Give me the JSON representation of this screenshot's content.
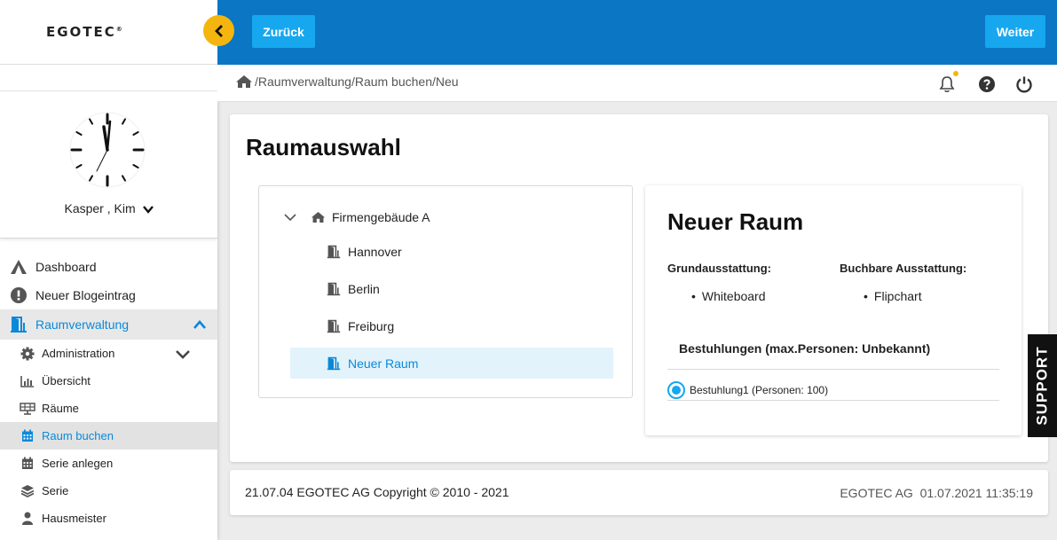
{
  "sidebar": {
    "logo": "EGOTEC",
    "logo_mark": "®",
    "user_name": "Kasper , Kim",
    "nav": [
      {
        "label": "Dashboard",
        "icon": "tent-icon"
      },
      {
        "label": "Neuer Blogeintrag",
        "icon": "alert-circle-icon"
      },
      {
        "label": "Raumverwaltung",
        "icon": "door-icon"
      }
    ],
    "sub_nav": [
      {
        "label": "Administration",
        "icon": "gear-icon"
      },
      {
        "label": "Übersicht",
        "icon": "bar-chart-icon"
      },
      {
        "label": "Räume",
        "icon": "solar-panel-icon"
      },
      {
        "label": "Raum buchen",
        "icon": "calendar-icon"
      },
      {
        "label": "Serie anlegen",
        "icon": "calendar-icon"
      },
      {
        "label": "Serie",
        "icon": "layers-icon"
      },
      {
        "label": "Hausmeister",
        "icon": "user-icon"
      }
    ]
  },
  "header": {
    "back_label": "Zurück",
    "next_label": "Weiter",
    "breadcrumb": "/Raumverwaltung/Raum buchen/Neu"
  },
  "main": {
    "title": "Raumauswahl",
    "tree": {
      "root": "Firmengebäude A",
      "rooms": [
        "Hannover",
        "Berlin",
        "Freiburg",
        "Neuer Raum"
      ]
    },
    "detail": {
      "title": "Neuer Raum",
      "basic_label": "Grundausstattung:",
      "basic_items": [
        "Whiteboard"
      ],
      "bookable_label": "Buchbare Ausstattung:",
      "bookable_items": [
        "Flipchart"
      ],
      "seating_label": "Bestuhlungen (max.Personen: Unbekannt)",
      "seating_option": "Bestuhlung1 (Personen: 100)"
    }
  },
  "support_label": "SUPPORT",
  "footer": {
    "left": "21.07.04 EGOTEC AG Copyright © 2010 - 2021",
    "right": "EGOTEC AG  01.07.2021 11:35:19"
  },
  "colors": {
    "topbar": "#0a76c4",
    "button": "#16a7ef",
    "accent": "#0a89d9",
    "collapse": "#f5b50f"
  }
}
